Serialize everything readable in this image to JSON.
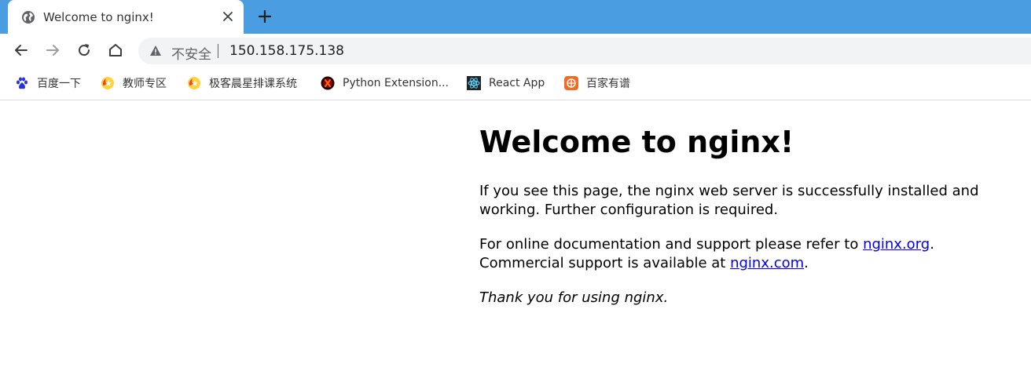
{
  "tab": {
    "title": "Welcome to nginx!",
    "favicon": "globe-icon"
  },
  "toolbar": {
    "security_label": "不安全",
    "url": "150.158.175.138"
  },
  "bookmarks": [
    {
      "label": "百度一下",
      "icon": "baidu-paw-icon"
    },
    {
      "label": "教师专区",
      "icon": "flame-star-icon"
    },
    {
      "label": "极客晨星排课系统",
      "icon": "flame-star-icon"
    },
    {
      "label": "Python Extension...",
      "icon": "python-extension-icon"
    },
    {
      "label": "React App",
      "icon": "react-icon"
    },
    {
      "label": "百家有谱",
      "icon": "baijia-icon"
    }
  ],
  "page": {
    "heading": "Welcome to nginx!",
    "para1": "If you see this page, the nginx web server is successfully installed and working. Further configuration is required.",
    "para2_prefix": "For online documentation and support please refer to ",
    "link_org": "nginx.org",
    "para2_mid": ".",
    "para2_line2": "Commercial support is available at ",
    "link_com": "nginx.com",
    "para2_end": ".",
    "thanks": "Thank you for using nginx."
  },
  "colors": {
    "tabstrip": "#4a9de1",
    "link": "#0000ee",
    "omnibox": "#f1f3f4"
  }
}
